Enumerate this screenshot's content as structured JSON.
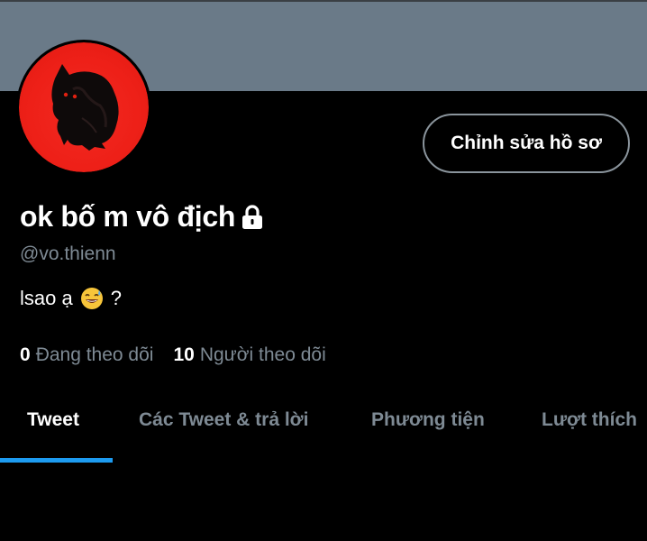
{
  "profile": {
    "display_name": "ok bố m vô địch",
    "handle": "@vo.thienn",
    "bio_text": "lsao ạ",
    "bio_emoji": "sweat-smile-emoji",
    "bio_suffix": "?",
    "edit_button_label": "Chỉnh sửa hồ sơ",
    "avatar_icon": "black-cat-on-red-avatar",
    "lock_icon": "lock-icon"
  },
  "stats": {
    "following_count": "0",
    "following_label": "Đang theo dõi",
    "followers_count": "10",
    "followers_label": "Người theo dõi"
  },
  "tabs": [
    {
      "label": "Tweet",
      "active": true
    },
    {
      "label": "Các Tweet & trả lời",
      "active": false
    },
    {
      "label": "Phương tiện",
      "active": false
    },
    {
      "label": "Lượt thích",
      "active": false
    }
  ],
  "colors": {
    "background": "#000000",
    "banner": "#6a7a88",
    "avatar_red": "#ee2018",
    "muted_text": "#7e8a94",
    "accent": "#1d9bf0",
    "button_border": "#8a949c"
  }
}
